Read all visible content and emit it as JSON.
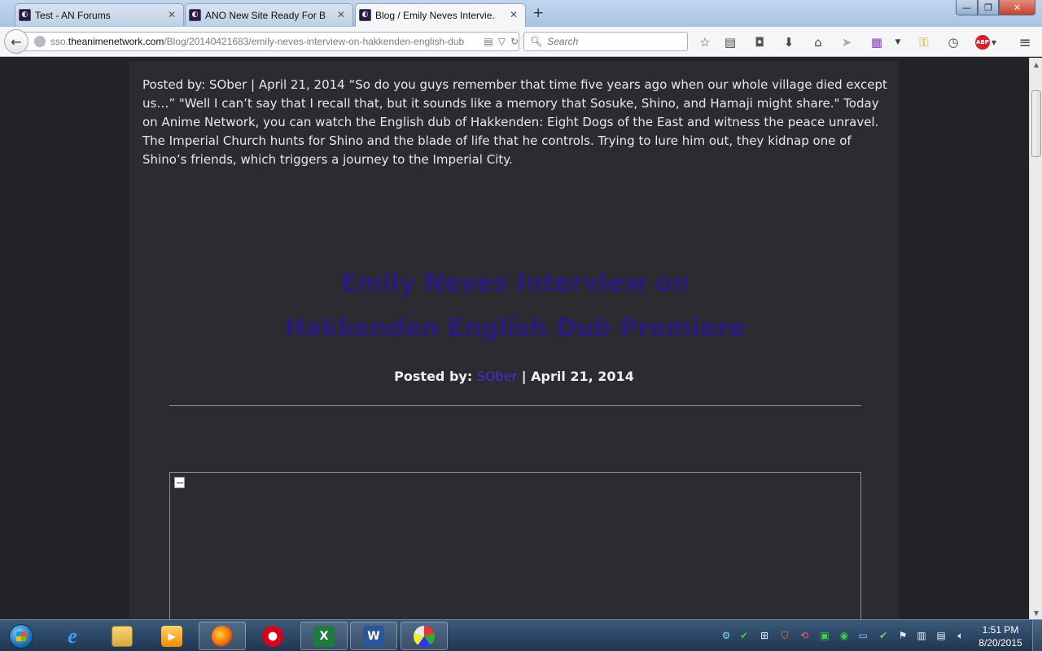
{
  "browser": {
    "tabs": [
      {
        "title": "Test - AN Forums",
        "active": false
      },
      {
        "title": "ANO New Site Ready For B...",
        "active": false
      },
      {
        "title": "Blog / Emily Neves Intervie...",
        "active": true
      }
    ],
    "newtab_label": "+",
    "url_prefix": "sso.",
    "url_domain": "theanimenetwork.com",
    "url_path": "/Blog/20140421683/emily-neves-interview-on-hakkenden-english-dub",
    "search_placeholder": "Search",
    "window_controls": {
      "minimize": "—",
      "maximize": "❐",
      "close": "✕"
    }
  },
  "toolbar_icons": [
    "bookmark-star-icon",
    "reading-list-icon",
    "pocket-icon",
    "download-icon",
    "home-icon",
    "send-icon",
    "grid-icon",
    "dropdown-icon",
    "key-icon",
    "history-icon",
    "adblock-icon",
    "menu-icon"
  ],
  "article": {
    "summary": "Posted by: SOber | April 21, 2014 “So do you guys remember that time five years ago when our whole village died except us…” \"Well I can’t say that I recall that, but it sounds like a memory that Sosuke, Shino, and Hamaji might share.\" Today on Anime Network, you can watch the English dub of Hakkenden: Eight Dogs of the East and witness the peace unravel. The Imperial Church hunts for Shino and the blade of life that he controls. Trying to lure him out, they kidnap one of Shino’s friends, which triggers a journey to the Imperial City.",
    "headline_line1": "Emily Neves Interview on",
    "headline_line2": "Hakkenden English Dub Premiere",
    "byline_prefix": "Posted by: ",
    "byline_author": "SOber",
    "byline_sep": " | ",
    "byline_date": "April 21, 2014"
  },
  "colors": {
    "page_bg": "#232228",
    "article_bg": "#2c2b31",
    "headline": "#2b1a7a",
    "author_link": "#3e2fd6"
  },
  "taskbar": {
    "apps": [
      "internet-explorer",
      "file-explorer",
      "media-player",
      "firefox",
      "opera",
      "excel",
      "word",
      "paint"
    ],
    "time": "1:51 PM",
    "date": "8/20/2015"
  }
}
